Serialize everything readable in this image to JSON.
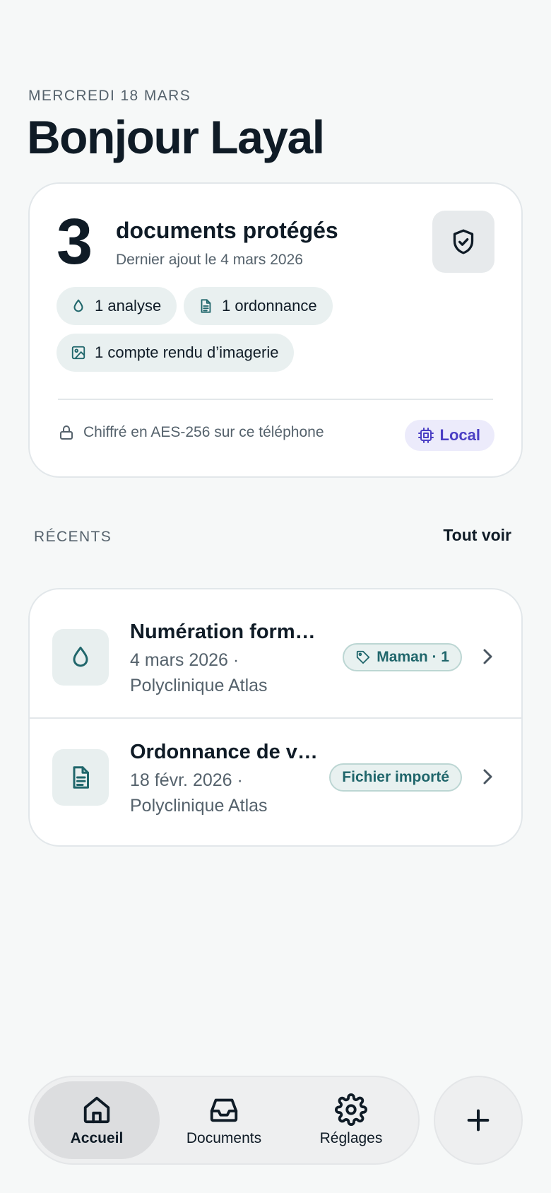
{
  "header": {
    "date": "MERCREDI 18 MARS",
    "greeting": "Bonjour Layal"
  },
  "summary": {
    "count": "3",
    "title": "documents protégés",
    "subtitle": "Dernier ajout le 4 mars 2026",
    "chips": [
      {
        "label": "1 analyse",
        "icon": "droplet-icon"
      },
      {
        "label": "1 ordonnance",
        "icon": "document-icon"
      },
      {
        "label": "1 compte rendu d’imagerie",
        "icon": "image-icon"
      }
    ],
    "encryption_text": "Chiffré en AES-256 sur ce téléphone",
    "local_badge": "Local"
  },
  "recents": {
    "section_label": "RÉCENTS",
    "see_all": "Tout voir",
    "items": [
      {
        "title": "Numération formule sanguine",
        "date": "4 mars 2026 ·",
        "place": "Polyclinique Atlas",
        "tag": "Maman · 1",
        "icon": "droplet-icon"
      },
      {
        "title": "Ordonnance de ville",
        "date": "18 févr. 2026 ·",
        "place": "Polyclinique Atlas",
        "tag": "Fichier importé",
        "icon": "document-icon"
      }
    ]
  },
  "nav": {
    "items": [
      {
        "label": "Accueil",
        "icon": "home-icon",
        "active": true
      },
      {
        "label": "Documents",
        "icon": "inbox-icon",
        "active": false
      },
      {
        "label": "Réglages",
        "icon": "gear-icon",
        "active": false
      }
    ],
    "add_icon": "plus-icon"
  },
  "colors": {
    "accent_teal": "#20666b",
    "local_purple": "#4b3fc4",
    "background": "#f6f8f8"
  }
}
